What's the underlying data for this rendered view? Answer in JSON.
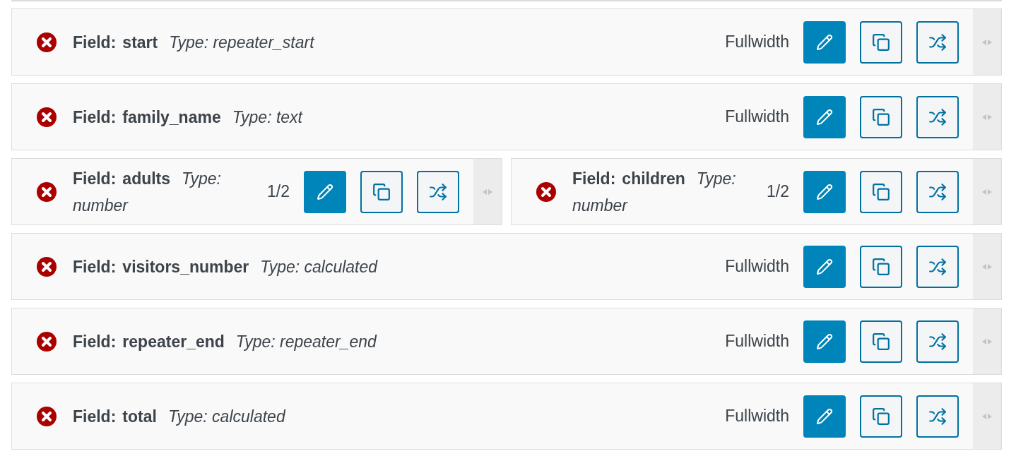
{
  "rows": [
    {
      "fields": [
        {
          "label": "Field:",
          "name": "start",
          "type": "Type: repeater_start",
          "width": "Fullwidth"
        }
      ]
    },
    {
      "fields": [
        {
          "label": "Field:",
          "name": "family_name",
          "type": "Type: text",
          "width": "Fullwidth"
        }
      ]
    },
    {
      "fields": [
        {
          "label": "Field:",
          "name": "adults",
          "type": "Type: number",
          "width": "1/2"
        },
        {
          "label": "Field:",
          "name": "children",
          "type": "Type: number",
          "width": "1/2"
        }
      ]
    },
    {
      "fields": [
        {
          "label": "Field:",
          "name": "visitors_number",
          "type": "Type: calculated",
          "width": "Fullwidth"
        }
      ]
    },
    {
      "fields": [
        {
          "label": "Field:",
          "name": "repeater_end",
          "type": "Type: repeater_end",
          "width": "Fullwidth"
        }
      ]
    },
    {
      "fields": [
        {
          "label": "Field:",
          "name": "total",
          "type": "Type: calculated",
          "width": "Fullwidth"
        }
      ]
    }
  ]
}
